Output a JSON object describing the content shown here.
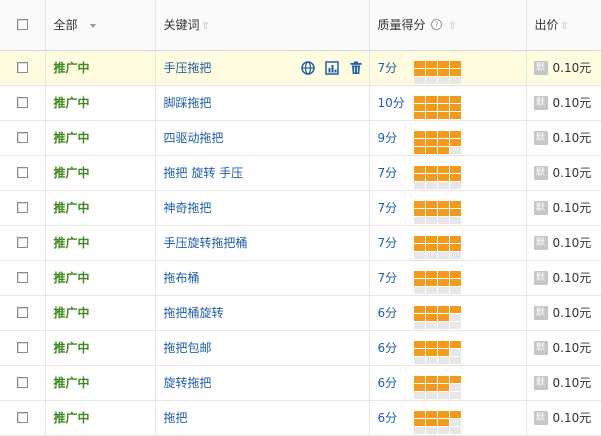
{
  "header": {
    "all_label": "全部",
    "keyword_label": "关键词",
    "quality_label": "质量得分",
    "bid_label": "出价"
  },
  "icons": {
    "sort": "sort-up-arrow-icon",
    "dropdown": "chevron-down-icon",
    "actions": [
      "globe-icon",
      "chart-icon",
      "trash-icon"
    ],
    "default_price": "default-price-icon"
  },
  "colors": {
    "status_green": "#3d8a1f",
    "link_blue": "#1f5ea8",
    "quality_on": "#f39a1b",
    "quality_off": "#e7e7e7",
    "highlight_row": "#fffcdf"
  },
  "rows": [
    {
      "status": "推广中",
      "keyword": "手压拖把",
      "score_text": "7分",
      "score": 7,
      "default_icon": "默",
      "price": "0.10元"
    },
    {
      "status": "推广中",
      "keyword": "脚踩拖把",
      "score_text": "10分",
      "score": 10,
      "default_icon": "默",
      "price": "0.10元"
    },
    {
      "status": "推广中",
      "keyword": "四驱动拖把",
      "score_text": "9分",
      "score": 9,
      "default_icon": "默",
      "price": "0.10元"
    },
    {
      "status": "推广中",
      "keyword": "拖把 旋转 手压",
      "score_text": "7分",
      "score": 7,
      "default_icon": "默",
      "price": "0.10元"
    },
    {
      "status": "推广中",
      "keyword": "神奇拖把",
      "score_text": "7分",
      "score": 7,
      "default_icon": "默",
      "price": "0.10元"
    },
    {
      "status": "推广中",
      "keyword": "手压旋转拖把桶",
      "score_text": "7分",
      "score": 7,
      "default_icon": "默",
      "price": "0.10元"
    },
    {
      "status": "推广中",
      "keyword": "拖布桶",
      "score_text": "7分",
      "score": 7,
      "default_icon": "默",
      "price": "0.10元"
    },
    {
      "status": "推广中",
      "keyword": "拖把桶旋转",
      "score_text": "6分",
      "score": 6,
      "default_icon": "默",
      "price": "0.10元"
    },
    {
      "status": "推广中",
      "keyword": "拖把包邮",
      "score_text": "6分",
      "score": 6,
      "default_icon": "默",
      "price": "0.10元"
    },
    {
      "status": "推广中",
      "keyword": "旋转拖把",
      "score_text": "6分",
      "score": 6,
      "default_icon": "默",
      "price": "0.10元"
    },
    {
      "status": "推广中",
      "keyword": "拖把",
      "score_text": "6分",
      "score": 6,
      "default_icon": "默",
      "price": "0.10元"
    }
  ]
}
